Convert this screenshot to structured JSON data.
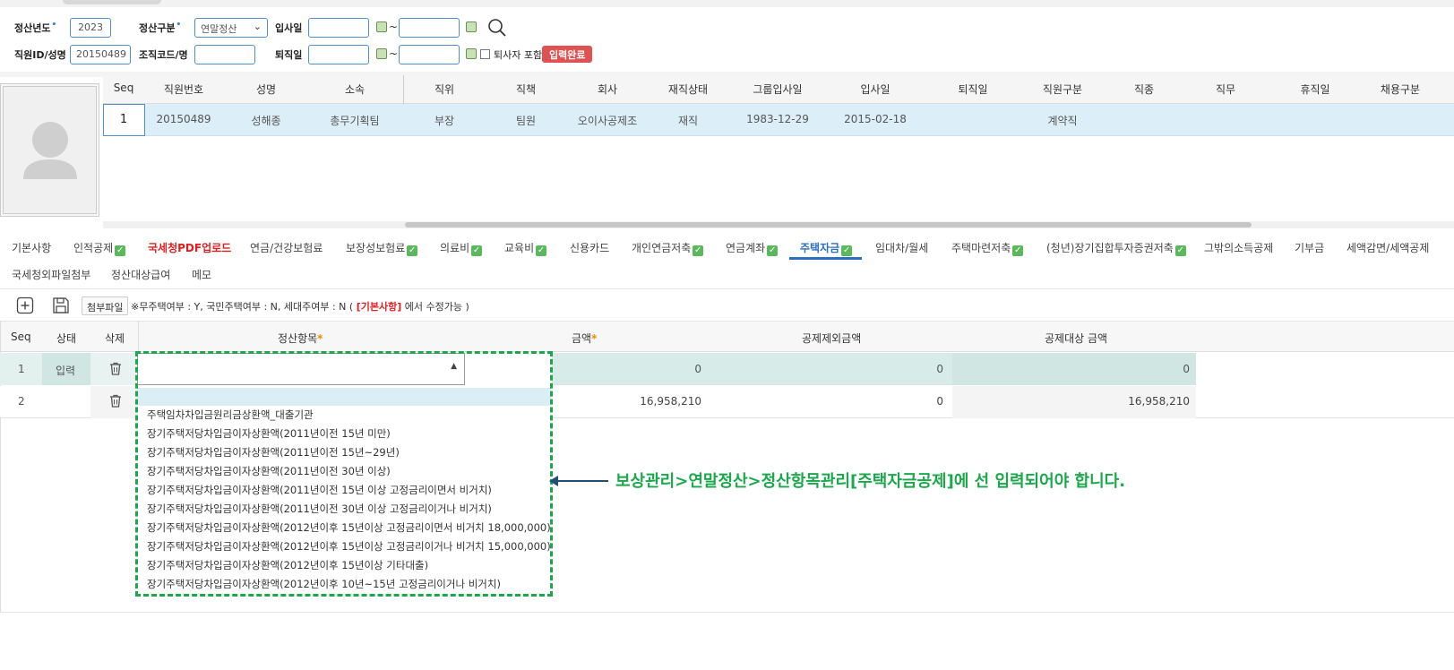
{
  "filters": {
    "year_label": "정산년도",
    "year_value": "2023",
    "type_label": "정산구분",
    "type_value": "연말정산",
    "hire_label": "입사일",
    "emp_label": "직원ID/성명",
    "emp_value": "20150489",
    "org_label": "조직코드/명",
    "retire_label": "퇴직일",
    "tilde": "~",
    "include_retired_label": "퇴사자 포함",
    "input_done_badge": "입력완료"
  },
  "emp_grid": {
    "headers": [
      "Seq",
      "직원번호",
      "성명",
      "소속",
      "직위",
      "직책",
      "회사",
      "재직상태",
      "그룹입사일",
      "입사일",
      "퇴직일",
      "직원구분",
      "직종",
      "직무",
      "휴직일",
      "채용구분"
    ],
    "row": {
      "seq": "1",
      "emp_no": "20150489",
      "name": "성해종",
      "dept": "총무기획팀",
      "position": "부장",
      "role": "팀원",
      "company": "오이사공제조",
      "status": "재직",
      "group_join": "1983-12-29",
      "join": "2015-02-18",
      "retire": "",
      "emp_type": "계약직"
    }
  },
  "tabs": {
    "row1": [
      "기본사항",
      "인적공제",
      "국세청PDF업로드",
      "연금/건강보험료",
      "보장성보험료",
      "의료비",
      "교육비",
      "신용카드",
      "개인연금저축",
      "연금계좌",
      "주택자금",
      "임대차/월세",
      "주택마련저축",
      "(청년)장기집합투자증권저축",
      "그밖의소득공제",
      "기부금",
      "세액감면/세액공제"
    ],
    "row2": [
      "국세청외파일첨부",
      "정산대상급여",
      "메모"
    ],
    "check_mark": "✓"
  },
  "toolbar": {
    "attach_label": "첨부파일",
    "notice_prefix": "※무주택여부 : Y, 국민주택여부 : N, 세대주여부 : N (",
    "notice_link": "[기본사항]",
    "notice_suffix": "에서 수정가능 )"
  },
  "detail_grid": {
    "headers": {
      "seq": "Seq",
      "status": "상태",
      "delete": "삭제",
      "item": "정산항목",
      "amount": "금액",
      "excluded": "공제제외금액",
      "target": "공제대상 금액",
      "required_mark": "*"
    },
    "rows": [
      {
        "seq": "1",
        "status": "입력",
        "item": "",
        "amount": "0",
        "excluded": "0",
        "target": "0"
      },
      {
        "seq": "2",
        "status": "",
        "item": "",
        "amount": "16,958,210",
        "excluded": "0",
        "target": "16,958,210"
      }
    ]
  },
  "dropdown_options": [
    "주택임차차입금원리금상환액_대출기관",
    "장기주택저당차입금이자상환액(2011년이전 15년 미만)",
    "장기주택저당차입금이자상환액(2011년이전 15년~29년)",
    "장기주택저당차입금이자상환액(2011년이전 30년 이상)",
    "장기주택저당차입금이자상환액(2011년이전 15년 이상 고정금리이면서 비거치)",
    "장기주택저당차입금이자상환액(2011년이전 30년 이상 고정금리이거나 비거치)",
    "장기주택저당차입금이자상환액(2012년이후 15년이상 고정금리이면서 비거치 18,000,000)",
    "장기주택저당차입금이자상환액(2012년이후 15년이상 고정금리이거나 비거치 15,000,000)",
    "장기주택저당차입금이자상환액(2012년이후 15년이상 기타대출)",
    "장기주택저당차입금이자상환액(2012년이후 10년~15년 고정금리이거나 비거치)"
  ],
  "annotation": "보상관리>연말정산>정산항목관리[주택자금공제]에 선 입력되어야 합니다.",
  "colors": {
    "accent_blue": "#4d8fcf",
    "badge_red": "#e05252",
    "annotation_green": "#1aa84a",
    "selected_row": "#dceef7",
    "input_row": "#d7ece9"
  },
  "icons": {
    "search": "search-icon",
    "add": "add-icon",
    "save": "save-icon",
    "trash": "trash-icon",
    "calendar": "calendar-icon",
    "avatar": "avatar-placeholder-icon"
  }
}
